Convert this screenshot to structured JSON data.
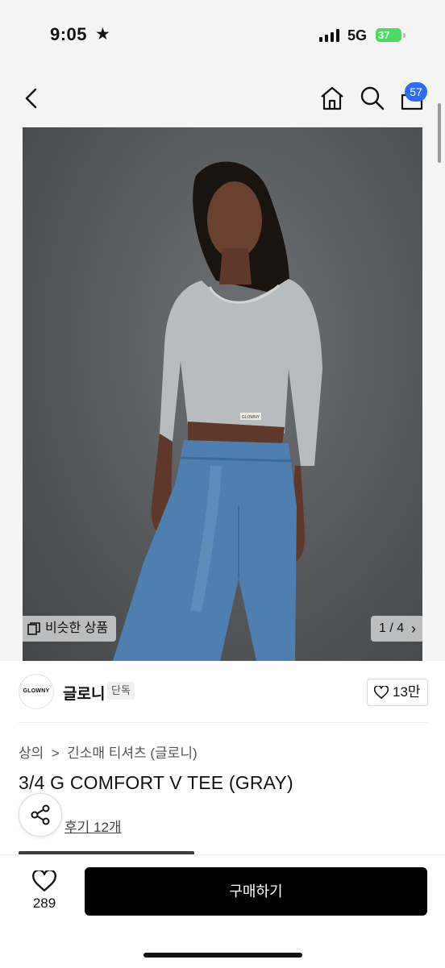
{
  "status_bar": {
    "time": "9:05",
    "star": "★",
    "network": "5G",
    "battery": "37"
  },
  "nav": {
    "cart_count": "57"
  },
  "image": {
    "similar_label": "비슷한 상품",
    "pager": "1 / 4",
    "pager_chevron": "›",
    "tag_text": "GLOWNY"
  },
  "brand": {
    "logo_text": "GLOWNY",
    "name": "글로니",
    "exclusive_badge": "단독",
    "likes": "13만"
  },
  "product": {
    "breadcrumb": "상의  >  긴소매 티셔츠 (글로니)",
    "title": "3/4 G COMFORT V TEE (GRAY)",
    "reviews": "후기 12개"
  },
  "bottom_bar": {
    "wish_count": "289",
    "buy_label": "구매하기"
  },
  "colors": {
    "badge_blue": "#2f6bf2",
    "battery_green": "#4cd964",
    "buy_button": "#000000"
  },
  "icons": [
    "back-chevron-icon",
    "home-icon",
    "search-icon",
    "cart-icon",
    "similar-items-icon",
    "heart-icon",
    "share-icon"
  ]
}
